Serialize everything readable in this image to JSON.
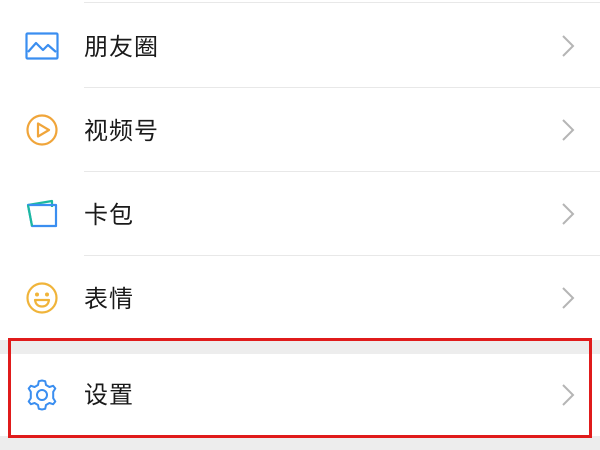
{
  "menu": {
    "items": [
      {
        "label": "朋友圈",
        "icon": "moments-picture-icon"
      },
      {
        "label": "视频号",
        "icon": "channels-play-icon"
      },
      {
        "label": "卡包",
        "icon": "card-wallet-icon"
      },
      {
        "label": "表情",
        "icon": "smiley-face-icon"
      }
    ],
    "settings": {
      "label": "设置",
      "icon": "gear-icon"
    }
  },
  "colors": {
    "moments_icon": "#3a8ef0",
    "channels_icon": "#f0a53a",
    "cards_icon_blue": "#3a8ef0",
    "cards_icon_teal": "#1cb9a0",
    "stickers_icon": "#f0b43a",
    "settings_icon": "#3a8ef0",
    "chevron": "#b5b5b5",
    "highlight": "#e01b1b",
    "separator": "#ededed"
  }
}
